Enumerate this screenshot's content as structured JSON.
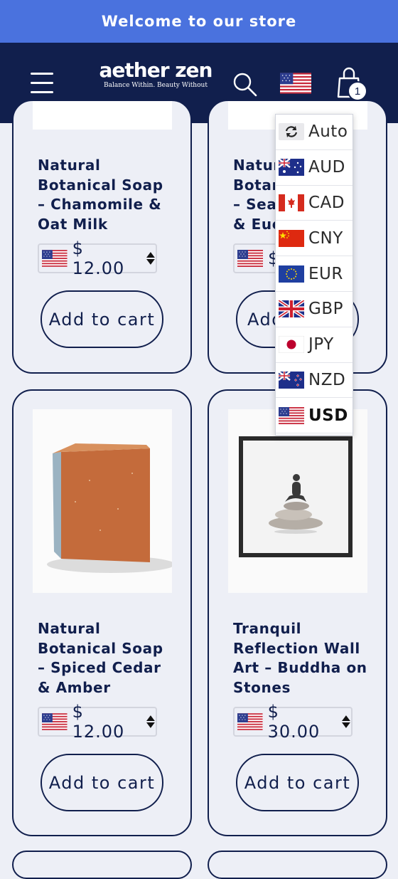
{
  "announcement": "Welcome to our store",
  "header": {
    "logo": "aether zen",
    "tagline": "Balance Within. Beauty Without",
    "cart_count": "1"
  },
  "products": [
    {
      "title_lines": [
        "Natural",
        "Botanical Soap",
        "– Chamomile &",
        "Oat Milk"
      ],
      "price": "$ 12.00",
      "button": "Add to cart"
    },
    {
      "title_lines": [
        "Natur",
        "Botan",
        "– Sea",
        "& Euc"
      ],
      "price": "$",
      "button": "Add"
    },
    {
      "title_lines": [
        "Natural",
        "Botanical Soap",
        "– Spiced Cedar",
        "& Amber"
      ],
      "price": "$ 12.00",
      "button": "Add to cart"
    },
    {
      "title_lines": [
        "Tranquil",
        "Reflection Wall",
        "Art – Buddha on",
        "Stones"
      ],
      "price": "$ 30.00",
      "button": "Add to cart"
    }
  ],
  "currency_menu": {
    "selected": "USD",
    "options": [
      {
        "code": "Auto",
        "icon": "refresh-icon"
      },
      {
        "code": "AUD",
        "icon": "australia-flag-icon"
      },
      {
        "code": "CAD",
        "icon": "canada-flag-icon"
      },
      {
        "code": "CNY",
        "icon": "china-flag-icon"
      },
      {
        "code": "EUR",
        "icon": "eu-flag-icon"
      },
      {
        "code": "GBP",
        "icon": "uk-flag-icon"
      },
      {
        "code": "JPY",
        "icon": "japan-flag-icon"
      },
      {
        "code": "NZD",
        "icon": "new-zealand-flag-icon"
      },
      {
        "code": "USD",
        "icon": "us-flag-icon"
      }
    ]
  },
  "colors": {
    "navy": "#111f4d",
    "announcement_bg": "#4a72de",
    "page_bg": "#edeff6"
  }
}
